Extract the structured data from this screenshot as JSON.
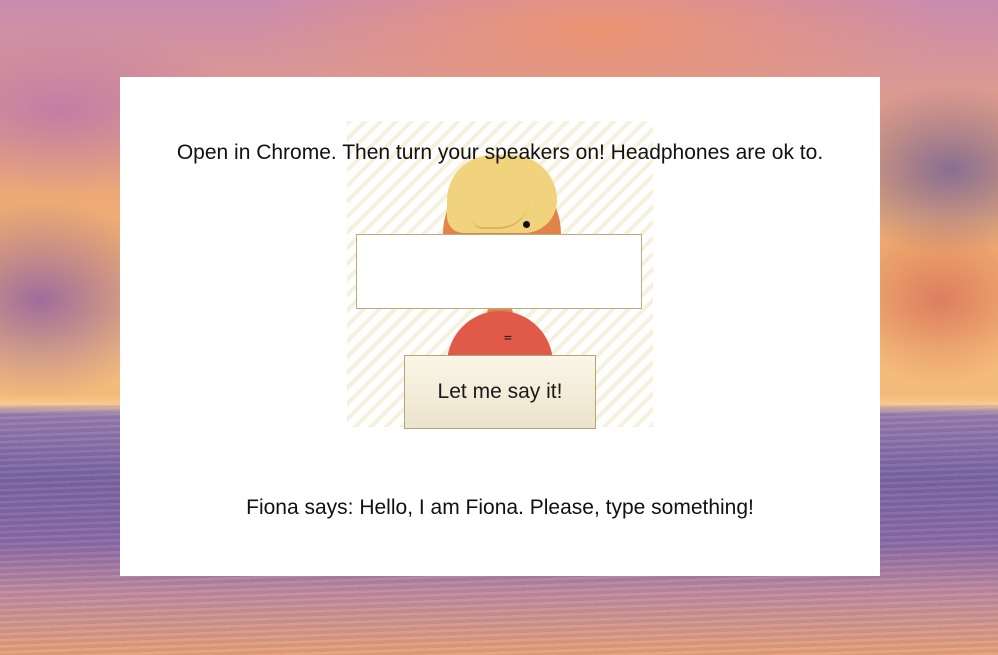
{
  "colors": {
    "card_background": "#ffffff",
    "button_gradient_top": "#fbf6e8",
    "button_gradient_bottom": "#ece3cb",
    "button_border": "#b3a47a",
    "hair": "#f1d27d",
    "skin": "#e2844a",
    "shirt": "#e15a49",
    "stripe": "#f6f1dc"
  },
  "header": {
    "instruction": "Open in Chrome. Then turn your speakers on! Headphones are ok to."
  },
  "character": {
    "shirt_mark": "="
  },
  "speech": {
    "input_value": "",
    "placeholder": ""
  },
  "actions": {
    "say_label": "Let me say it!"
  },
  "output": {
    "fiona_message": "Fiona says: Hello, I am Fiona. Please, type something!"
  }
}
